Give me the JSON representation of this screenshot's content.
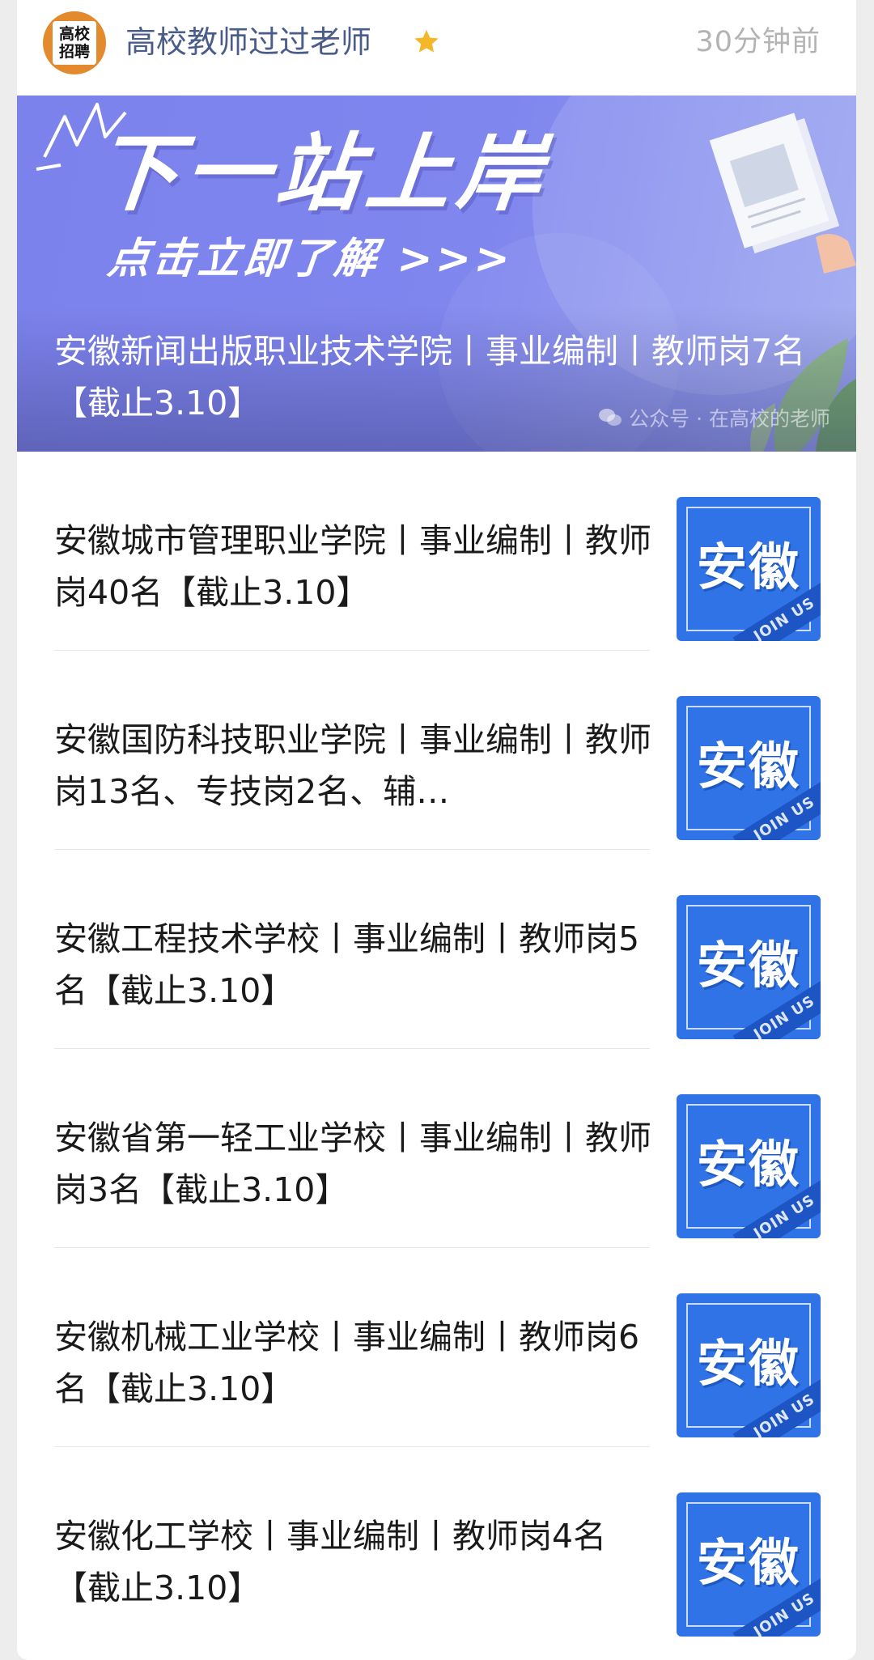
{
  "header": {
    "avatar_lines": [
      "高校",
      "招聘"
    ],
    "account_name": "高校教师过过老师",
    "timestamp": "30分钟前",
    "star_icon": "star-icon",
    "star_color": "#f5b72a"
  },
  "banner": {
    "headline": "下一站上岸",
    "cta": "点击立即了解 >>>",
    "title": "安徽新闻出版职业技术学院丨事业编制丨教师岗7名【截止3.10】",
    "watermark": "公众号 · 在高校的老师",
    "background_color": "#7c82ec"
  },
  "articles": [
    {
      "title": "安徽城市管理职业学院丨事业编制丨教师岗40名【截止3.10】",
      "thumb_text": "安徽",
      "thumb_tag": "JOIN US"
    },
    {
      "title": "安徽国防科技职业学院丨事业编制丨教师岗13名、专技岗2名、辅…",
      "thumb_text": "安徽",
      "thumb_tag": "JOIN US"
    },
    {
      "title": "安徽工程技术学校丨事业编制丨教师岗5名【截止3.10】",
      "thumb_text": "安徽",
      "thumb_tag": "JOIN US"
    },
    {
      "title": "安徽省第一轻工业学校丨事业编制丨教师岗3名【截止3.10】",
      "thumb_text": "安徽",
      "thumb_tag": "JOIN US"
    },
    {
      "title": "安徽机械工业学校丨事业编制丨教师岗6名【截止3.10】",
      "thumb_text": "安徽",
      "thumb_tag": "JOIN US"
    },
    {
      "title": "安徽化工学校丨事业编制丨教师岗4名【截止3.10】",
      "thumb_text": "安徽",
      "thumb_tag": "JOIN US"
    }
  ],
  "colors": {
    "thumb_blue": "#2f73e6",
    "account_name": "#4a5d8a"
  }
}
